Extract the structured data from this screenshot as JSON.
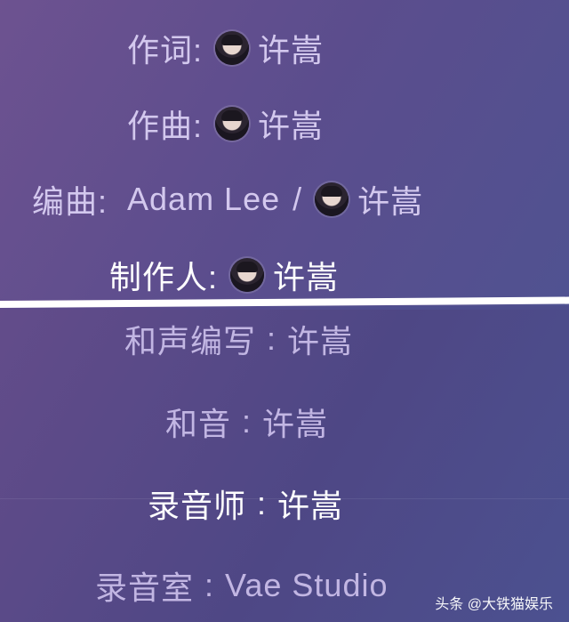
{
  "credits_top": [
    {
      "label": "作词:",
      "name": "许嵩"
    },
    {
      "label": "作曲:",
      "name": "许嵩"
    },
    {
      "label": "编曲:",
      "prefix": "Adam Lee",
      "slash": "/",
      "name": "许嵩"
    },
    {
      "label": "制作人:",
      "name": "许嵩"
    }
  ],
  "credits_bottom": [
    {
      "label": "和声编写",
      "sep": ":",
      "name": "许嵩"
    },
    {
      "label": "和音",
      "sep": ":",
      "name": "许嵩"
    },
    {
      "label": "录音师",
      "sep": ":",
      "name": "许嵩"
    },
    {
      "label": "录音室",
      "sep": ":",
      "name": "Vae Studio"
    }
  ],
  "watermark": {
    "text": "头条 @大铁猫娱乐"
  },
  "colors": {
    "text": "#d3c8ee",
    "active": "#ffffff",
    "divider": "#ffffff"
  }
}
